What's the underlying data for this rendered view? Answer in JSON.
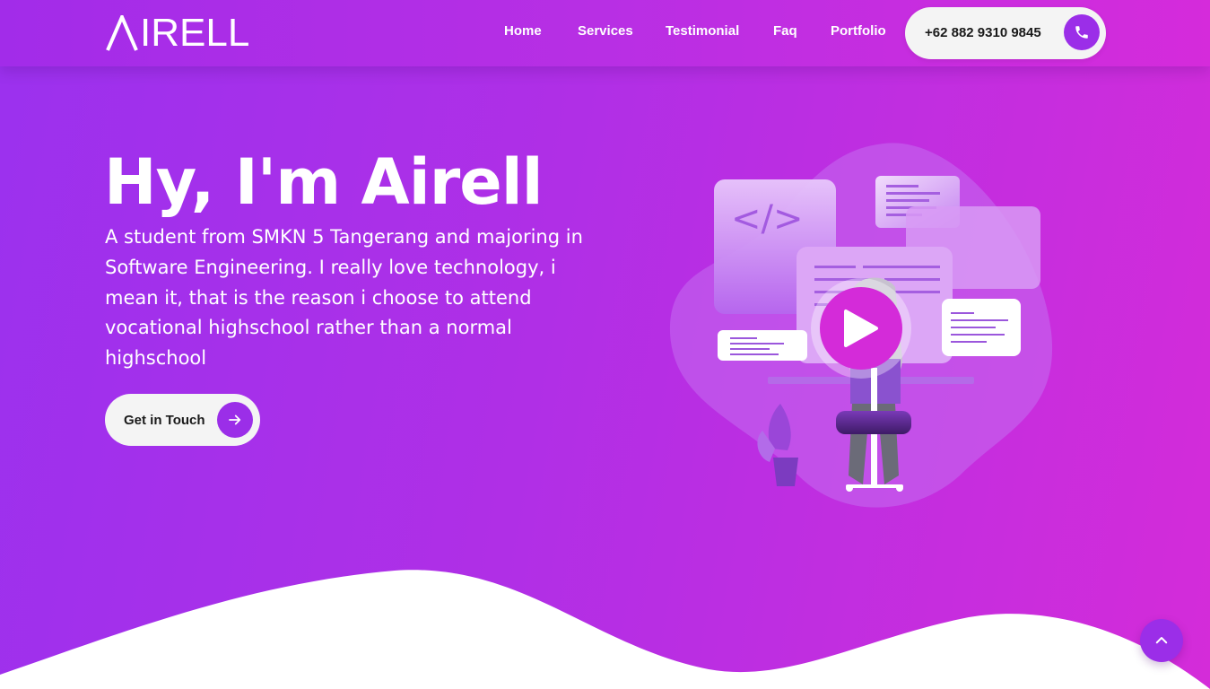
{
  "brand": {
    "logo_text": "IRELL"
  },
  "nav": {
    "items": [
      {
        "label": "Home"
      },
      {
        "label": "Services"
      },
      {
        "label": "Testimonial"
      },
      {
        "label": "Faq"
      },
      {
        "label": "Portfolio"
      }
    ],
    "phone": {
      "number": "+62 882 9310 9845",
      "icon": "phone-icon"
    }
  },
  "hero": {
    "title": "Hy, I'm Airell",
    "description": "A student from SMKN 5 Tangerang and majoring in Software Engineering. I really love technology, i mean it, that is the reason i choose to attend vocational highschool rather than a normal highschool",
    "cta": {
      "label": "Get in Touch",
      "icon": "arrow-right-icon"
    },
    "illustration": {
      "code_label": "</>",
      "play_icon": "play-icon"
    }
  },
  "back_to_top": {
    "icon": "chevron-up-icon"
  },
  "colors": {
    "accent": "#9b2ee8",
    "gradient_start": "#9b31ee",
    "gradient_end": "#d42cd9",
    "pill_bg": "#f4f4f4",
    "wave": "#ffffff"
  }
}
